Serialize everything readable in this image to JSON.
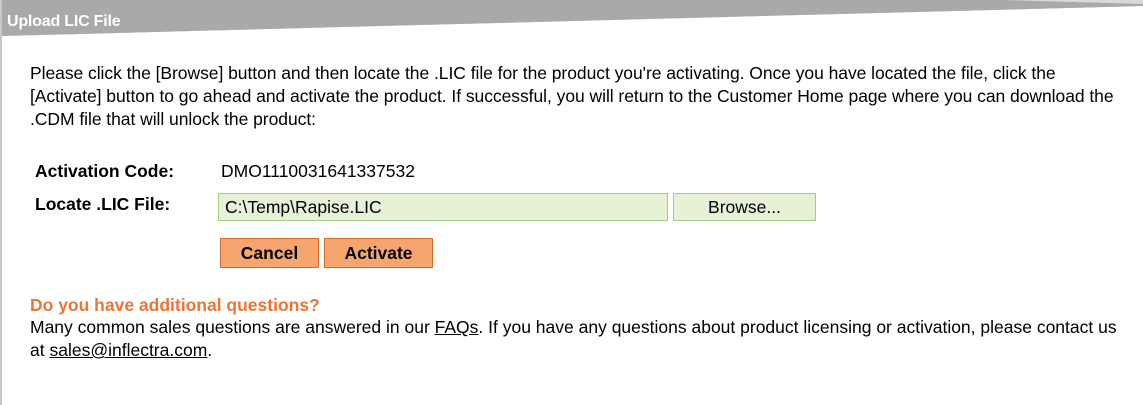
{
  "panel": {
    "title": "Upload LIC File",
    "intro": "Please click the [Browse] button and then locate the .LIC file for the product you're activating. Once you have located the file, click the [Activate] button to go ahead and activate the product. If successful, you will return to the Customer Home page where you can download the .CDM file that will unlock the product:"
  },
  "form": {
    "activation_code_label": "Activation Code:",
    "activation_code_value": "DMO1110031641337532",
    "locate_label": "Locate .LIC File:",
    "file_value": "C:\\Temp\\Rapise.LIC",
    "browse_label": "Browse...",
    "cancel_label": "Cancel",
    "activate_label": "Activate"
  },
  "questions": {
    "heading": "Do you have additional questions?",
    "text_1": "Many common sales questions are answered in our ",
    "faq_link": "FAQs",
    "text_2": ". If you have any questions about product licensing or activation, please contact us at ",
    "email_link": "sales@inflectra.com",
    "text_3": "."
  },
  "colors": {
    "header_bar": "#a9a9a9",
    "input_background": "#e6f2d6",
    "input_border": "#9fcf7f",
    "button_orange": "#f7a56e",
    "button_border": "#d8692e",
    "heading_orange": "#ee7433"
  }
}
